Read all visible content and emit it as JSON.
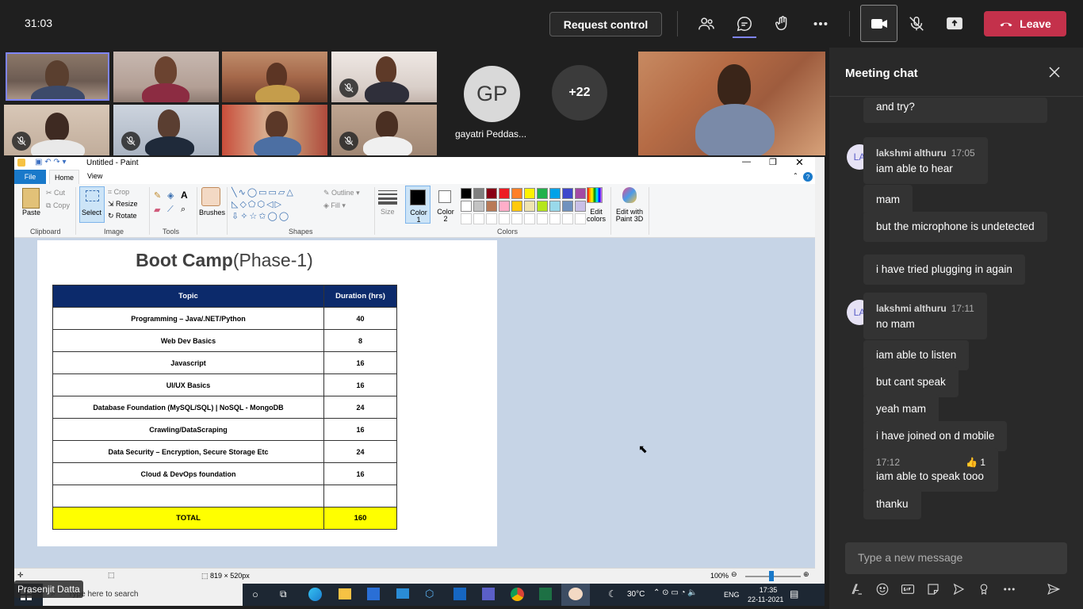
{
  "topbar": {
    "timer": "31:03",
    "request_control": "Request control",
    "leave": "Leave"
  },
  "participants": {
    "gp_initials": "GP",
    "gp_name": "gayatri Peddas...",
    "more_count": "+22"
  },
  "paint": {
    "title": "Untitled - Paint",
    "tabs": [
      "File",
      "Home",
      "View"
    ],
    "groups": {
      "clipboard": "Clipboard",
      "image": "Image",
      "tools": "Tools",
      "shapes": "Shapes",
      "colors": "Colors"
    },
    "buttons": {
      "paste": "Paste",
      "cut": "Cut",
      "copy": "Copy",
      "select": "Select",
      "crop": "Crop",
      "resize": "Resize",
      "rotate": "Rotate",
      "brushes": "Brushes",
      "outline": "Outline",
      "fill": "Fill",
      "size": "Size",
      "color1": "Color 1",
      "color2": "Color 2",
      "edit_colors": "Edit colors",
      "paint3d": "Edit with Paint 3D"
    },
    "palette": [
      "#000000",
      "#7f7f7f",
      "#880015",
      "#ed1c24",
      "#ff7f27",
      "#fff200",
      "#22b14c",
      "#00a2e8",
      "#3f48cc",
      "#a349a4",
      "#ffffff",
      "#c3c3c3",
      "#b97a57",
      "#ffaec9",
      "#ffc90e",
      "#efe4b0",
      "#b5e61d",
      "#99d9ea",
      "#7092be",
      "#c8bfe7"
    ],
    "status_size": "819 × 520px",
    "zoom": "100%"
  },
  "canvas": {
    "title_bold": "Boot Camp",
    "title_rest": "(Phase-1)",
    "headers": [
      "Topic",
      "Duration (hrs)"
    ],
    "rows": [
      {
        "topic": "Programming – Java/.NET/Python",
        "hours": "40"
      },
      {
        "topic": "Web Dev Basics",
        "hours": "8"
      },
      {
        "topic": "Javascript",
        "hours": "16"
      },
      {
        "topic": "UI/UX Basics",
        "hours": "16"
      },
      {
        "topic": "Database Foundation (MySQL/SQL)  | NoSQL - MongoDB",
        "hours": "24"
      },
      {
        "topic": "Crawling/DataScraping",
        "hours": "16"
      },
      {
        "topic": "Data Security – Encryption, Secure Storage Etc",
        "hours": "24"
      },
      {
        "topic": "Cloud & DevOps foundation",
        "hours": "16"
      },
      {
        "topic": "",
        "hours": ""
      }
    ],
    "total_label": "TOTAL",
    "total_value": "160"
  },
  "taskbar": {
    "search": "Type here to search",
    "weather": "30°C",
    "lang": "ENG",
    "time": "17:35",
    "date": "22-11-2021"
  },
  "presenter": "Prasenjit Datta",
  "chat": {
    "title": "Meeting chat",
    "top_partial": "and try?",
    "groups": [
      {
        "initials": "LA",
        "sender": "lakshmi althuru",
        "time": "17:05",
        "messages": [
          "iam able to hear",
          "mam",
          "but the microphone is undetected",
          "i have tried plugging in again"
        ]
      },
      {
        "initials": "LA",
        "sender": "lakshmi althuru",
        "time": "17:11",
        "messages": [
          "no mam",
          "iam able to listen",
          "but cant speak",
          "yeah mam",
          "i have joined on d mobile"
        ]
      }
    ],
    "late": {
      "time": "17:12",
      "reaction_count": "1",
      "message": "iam able to speak tooo"
    },
    "last": "thanku",
    "compose_placeholder": "Type a new message"
  }
}
